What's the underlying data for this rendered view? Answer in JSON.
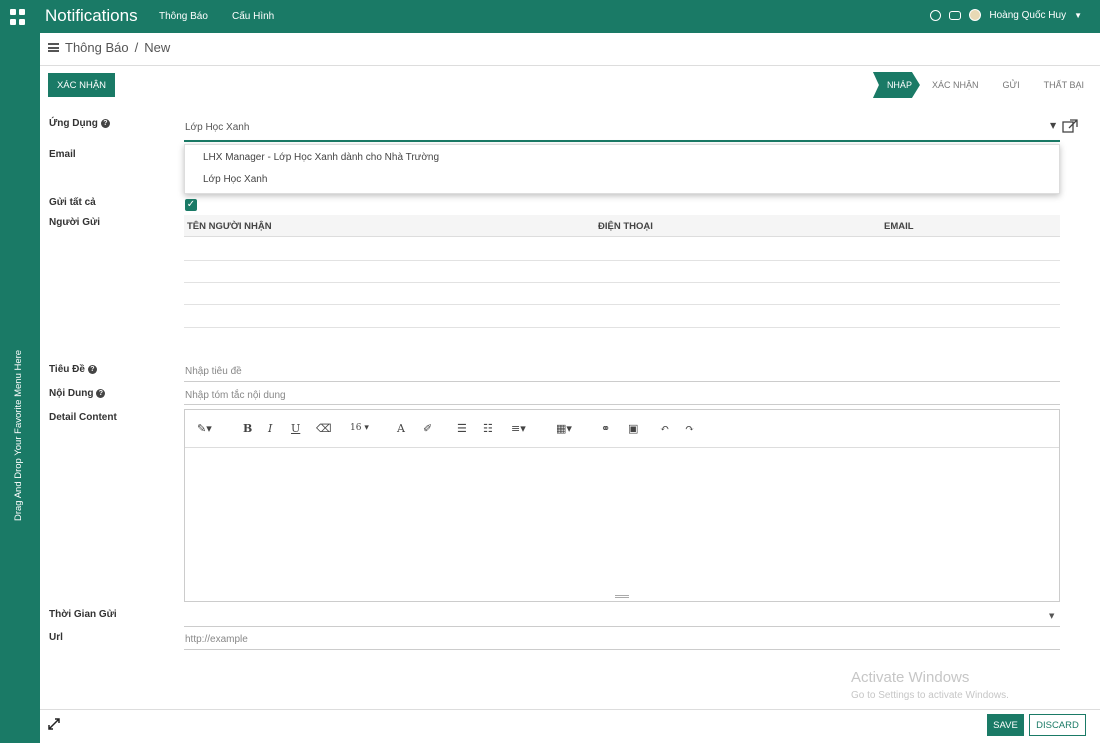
{
  "app": {
    "title": "Notifications",
    "menu": [
      "Thông Báo",
      "Cấu Hình"
    ],
    "user_name": "Hoàng Quốc Huy",
    "sidebar_hint": "Drag And Drop Your Favorite Menu Here",
    "accent_color": "#1a7a66"
  },
  "breadcrumb": {
    "root": "Thông Báo",
    "separator": "/",
    "current": "New"
  },
  "actions": {
    "confirm_label": "XÁC NHẬN",
    "save_label": "SAVE",
    "discard_label": "DISCARD"
  },
  "status_steps": [
    {
      "label": "NHÁP",
      "active": true
    },
    {
      "label": "XÁC NHẬN",
      "active": false
    },
    {
      "label": "GỬI",
      "active": false
    },
    {
      "label": "THẤT BẠI",
      "active": false
    }
  ],
  "form": {
    "app_label": "Ứng Dụng",
    "app_value": "Lớp Học Xanh",
    "email_label": "Email",
    "send_all_label": "Gửi tất cả",
    "send_all_checked": true,
    "sender_label": "Người Gửi",
    "title_label": "Tiêu Đề",
    "title_placeholder": "Nhập tiêu đề",
    "content_label": "Nội Dung",
    "content_placeholder": "Nhập tóm tắc nội dung",
    "detail_label": "Detail Content",
    "send_time_label": "Thời Gian Gửi",
    "url_label": "Url",
    "url_placeholder": "http://example"
  },
  "dropdown_options": [
    "LHX Manager - Lớp Học Xanh dành cho Nhà Trường",
    "Lớp Học Xanh"
  ],
  "recipients_table": {
    "columns": [
      "TÊN NGƯỜI NHẬN",
      "ĐIỆN THOẠI",
      "EMAIL"
    ],
    "rows": []
  },
  "editor_toolbar": {
    "font_size": "16",
    "bold": "B",
    "italic": "I",
    "underline": "U",
    "font_color": "A"
  },
  "watermark": {
    "line1": "Activate Windows",
    "line2": "Go to Settings to activate Windows."
  }
}
